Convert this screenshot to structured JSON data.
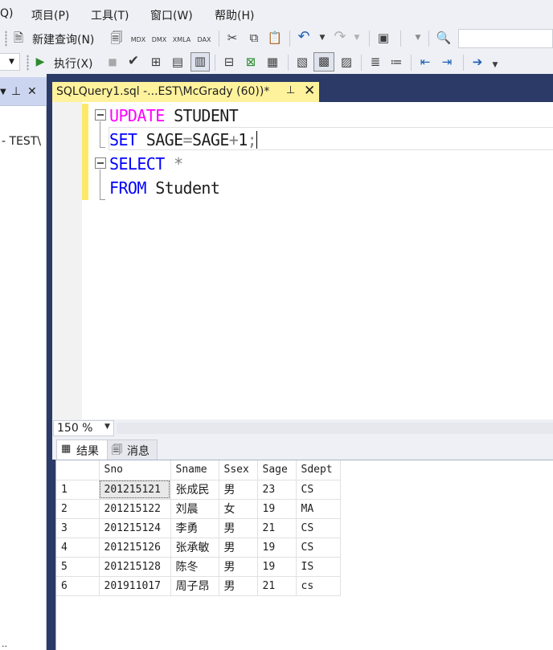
{
  "menu": [
    "Q)",
    "项目(P)",
    "工具(T)",
    "窗口(W)",
    "帮助(H)"
  ],
  "toolbar1": {
    "new_query": "新建查询(N)",
    "mdx": "MDX",
    "dmx": "DMX",
    "xmla": "XMLA",
    "dax": "DAX"
  },
  "toolbar2": {
    "execute": "执行(X)"
  },
  "object_explorer": {
    "pin": "⊥",
    "close": "✕",
    "server_node": "- TEST\\"
  },
  "editor_tab": {
    "title": "SQLQuery1.sql -...EST\\McGrady (60))*",
    "pin": "⊥",
    "close": "✕"
  },
  "code": {
    "line1_kw": "UPDATE",
    "line1_rest": " STUDENT",
    "line2_kw": "SET",
    "line2_a": " SAGE",
    "line2_eq": "=",
    "line2_b": "SAGE",
    "line2_plus": "+",
    "line2_c": "1",
    "line2_semi": ";",
    "line3_kw": "SELECT",
    "line3_star": " *",
    "line4_kw": "FROM",
    "line4_rest": " Student"
  },
  "zoom": "150 %",
  "result_tabs": {
    "results": "结果",
    "messages": "消息"
  },
  "grid": {
    "columns": [
      "Sno",
      "Sname",
      "Ssex",
      "Sage",
      "Sdept"
    ],
    "rows": [
      {
        "num": "1",
        "sno": "201215121",
        "sname": "张成民",
        "ssex": "男",
        "sage": "23",
        "sdept": "CS"
      },
      {
        "num": "2",
        "sno": "201215122",
        "sname": "刘晨",
        "ssex": "女",
        "sage": "19",
        "sdept": "MA"
      },
      {
        "num": "3",
        "sno": "201215124",
        "sname": "李勇",
        "ssex": "男",
        "sage": "21",
        "sdept": "CS"
      },
      {
        "num": "4",
        "sno": "201215126",
        "sname": "张承敏",
        "ssex": "男",
        "sage": "19",
        "sdept": "CS"
      },
      {
        "num": "5",
        "sno": "201215128",
        "sname": "陈冬",
        "ssex": "男",
        "sage": "19",
        "sdept": "IS"
      },
      {
        "num": "6",
        "sno": "201911017",
        "sname": "周子昂",
        "ssex": "男",
        "sage": "21",
        "sdept": "cs"
      }
    ]
  }
}
